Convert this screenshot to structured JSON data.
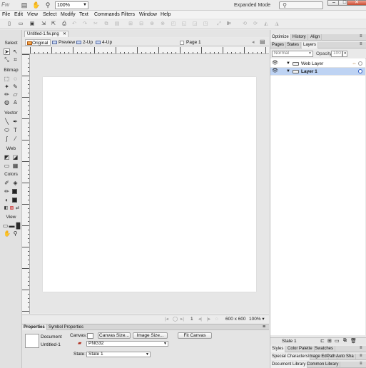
{
  "titlebar": {
    "logo": "Fw",
    "zoom": "100%",
    "mode": "Expanded Mode",
    "search_placeholder": ""
  },
  "menu": [
    "File",
    "Edit",
    "View",
    "Select",
    "Modify",
    "Text",
    "Commands",
    "Filters",
    "Window",
    "Help"
  ],
  "document": {
    "tab_label": "Untitled-1.fw.png",
    "view_tabs": [
      "Original",
      "Preview",
      "2-Up",
      "4-Up"
    ],
    "page": "Page 1"
  },
  "tools": {
    "sections": [
      "Select",
      "Bitmap",
      "Vector",
      "Web",
      "Colors",
      "View"
    ]
  },
  "statusbar": {
    "page_index": "1",
    "size": "600 x 600",
    "zoom": "100%"
  },
  "properties": {
    "tabs": [
      "Properties",
      "Symbol Properties"
    ],
    "doc_type": "Document",
    "doc_name": "Untitled-1",
    "canvas_label": "Canvas:",
    "canvas_size_btn": "Canvas Size...",
    "image_size_btn": "Image Size...",
    "fit_canvas_btn": "Fit Canvas",
    "format": "PNG32",
    "state_label": "State:",
    "state_value": "State 1"
  },
  "right_panel": {
    "top_tabs": [
      "Optimize",
      "History",
      "Align"
    ],
    "layer_tabs": [
      "Pages",
      "States",
      "Layers"
    ],
    "blend_mode": "Normal",
    "opacity_label": "Opacity",
    "opacity_value": "100",
    "layers": [
      "Web Layer",
      "Layer 1"
    ],
    "footer_state": "State 1",
    "bottom_tabs_1": [
      "Styles",
      "Color Palette",
      "Swatches"
    ],
    "bottom_tabs_2": [
      "Special Characters",
      "Image Ed",
      "Path",
      "Auto Sha"
    ],
    "bottom_tabs_3": [
      "Document Library",
      "Common Library"
    ]
  }
}
